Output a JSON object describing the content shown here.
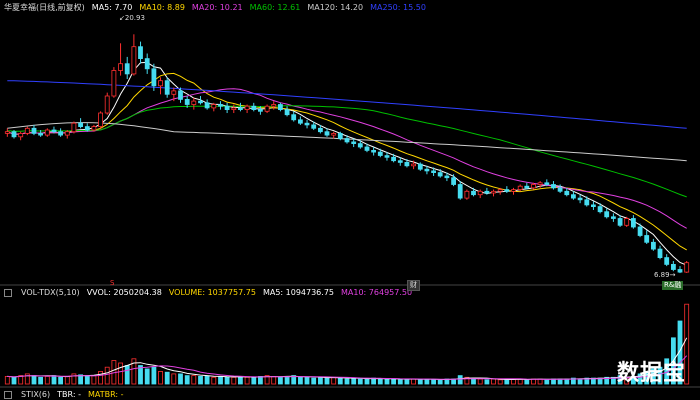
{
  "top_legend": {
    "title": "华夏幸福(日线,前复权)",
    "ma5": "MA5: 7.70",
    "ma10": "MA10: 8.89",
    "ma20": "MA20: 10.21",
    "ma60": "MA60: 12.61",
    "ma120": "MA120: 14.20",
    "ma250": "MA250: 15.50"
  },
  "volume_legend": {
    "name": "VOL-TDX(5,10)",
    "vvol": "VVOL: 2050204.38",
    "volume": "VOLUME: 1037757.75",
    "ma5": "MA5: 1094736.75",
    "ma10": "MA10: 764957.50"
  },
  "bottom_legend": {
    "name": "STIX(6)",
    "tbr": "TBR: -",
    "matbr": "MATBR: -"
  },
  "annotations": {
    "high": "20.93",
    "low": "6.89",
    "cai": "财",
    "rz": "R&融",
    "s": "S"
  },
  "watermark": "数据宝",
  "colors": {
    "up": "#ff3030",
    "down": "#46dcf0",
    "ma5": "#ffffff",
    "ma10": "#ffd700",
    "ma20": "#e040e0",
    "ma60": "#00c000",
    "ma120": "#cccccc",
    "ma250": "#3040ff"
  },
  "chart_data": {
    "type": "candlestick",
    "price_high": 20.93,
    "price_low": 6.89,
    "candles": [
      [
        15.1,
        15.4,
        14.9,
        15.2
      ],
      [
        15.2,
        15.3,
        14.8,
        14.9
      ],
      [
        14.9,
        15.2,
        14.7,
        15.1
      ],
      [
        15.1,
        15.5,
        15.0,
        15.4
      ],
      [
        15.4,
        15.6,
        15.0,
        15.1
      ],
      [
        15.1,
        15.3,
        14.9,
        15.0
      ],
      [
        15.0,
        15.4,
        14.9,
        15.3
      ],
      [
        15.3,
        15.5,
        15.1,
        15.2
      ],
      [
        15.2,
        15.4,
        14.9,
        15.0
      ],
      [
        15.0,
        15.3,
        14.8,
        15.2
      ],
      [
        15.2,
        15.8,
        15.1,
        15.7
      ],
      [
        15.7,
        16.0,
        15.4,
        15.5
      ],
      [
        15.5,
        15.7,
        15.2,
        15.3
      ],
      [
        15.3,
        15.6,
        15.2,
        15.5
      ],
      [
        15.5,
        16.4,
        15.4,
        16.3
      ],
      [
        16.3,
        17.5,
        16.2,
        17.3
      ],
      [
        17.3,
        19.0,
        17.2,
        18.8
      ],
      [
        18.8,
        20.4,
        18.5,
        19.2
      ],
      [
        19.2,
        19.6,
        18.3,
        18.6
      ],
      [
        18.6,
        20.93,
        18.5,
        20.2
      ],
      [
        20.2,
        20.5,
        19.2,
        19.5
      ],
      [
        19.5,
        19.8,
        18.6,
        18.9
      ],
      [
        18.9,
        19.2,
        17.6,
        17.9
      ],
      [
        17.9,
        18.4,
        17.4,
        18.2
      ],
      [
        18.2,
        18.4,
        17.2,
        17.4
      ],
      [
        17.4,
        17.8,
        17.0,
        17.6
      ],
      [
        17.6,
        17.8,
        16.9,
        17.1
      ],
      [
        17.1,
        17.3,
        16.6,
        16.8
      ],
      [
        16.8,
        17.2,
        16.5,
        17.0
      ],
      [
        17.0,
        17.3,
        16.8,
        16.9
      ],
      [
        16.9,
        17.1,
        16.5,
        16.6
      ],
      [
        16.6,
        16.9,
        16.4,
        16.8
      ],
      [
        16.8,
        17.0,
        16.5,
        16.7
      ],
      [
        16.7,
        16.9,
        16.3,
        16.5
      ],
      [
        16.5,
        16.8,
        16.3,
        16.6
      ],
      [
        16.6,
        16.9,
        16.4,
        16.5
      ],
      [
        16.5,
        16.8,
        16.3,
        16.7
      ],
      [
        16.7,
        16.9,
        16.4,
        16.5
      ],
      [
        16.5,
        16.7,
        16.2,
        16.4
      ],
      [
        16.4,
        16.8,
        16.3,
        16.7
      ],
      [
        16.7,
        17.0,
        16.5,
        16.8
      ],
      [
        16.8,
        16.9,
        16.4,
        16.5
      ],
      [
        16.5,
        16.7,
        16.1,
        16.2
      ],
      [
        16.2,
        16.4,
        15.8,
        15.9
      ],
      [
        15.9,
        16.1,
        15.6,
        15.7
      ],
      [
        15.7,
        15.9,
        15.4,
        15.6
      ],
      [
        15.6,
        15.8,
        15.3,
        15.4
      ],
      [
        15.4,
        15.6,
        15.1,
        15.2
      ],
      [
        15.2,
        15.4,
        14.9,
        15.0
      ],
      [
        15.0,
        15.2,
        14.8,
        15.1
      ],
      [
        15.1,
        15.2,
        14.7,
        14.8
      ],
      [
        14.8,
        15.0,
        14.5,
        14.6
      ],
      [
        14.6,
        14.8,
        14.3,
        14.5
      ],
      [
        14.5,
        14.7,
        14.2,
        14.3
      ],
      [
        14.3,
        14.5,
        14.0,
        14.1
      ],
      [
        14.1,
        14.3,
        13.8,
        14.0
      ],
      [
        14.0,
        14.2,
        13.7,
        13.8
      ],
      [
        13.8,
        14.0,
        13.5,
        13.7
      ],
      [
        13.7,
        13.9,
        13.4,
        13.5
      ],
      [
        13.5,
        13.7,
        13.2,
        13.4
      ],
      [
        13.4,
        13.6,
        13.1,
        13.2
      ],
      [
        13.2,
        13.5,
        13.0,
        13.3
      ],
      [
        13.3,
        13.4,
        12.9,
        13.0
      ],
      [
        13.0,
        13.2,
        12.7,
        12.9
      ],
      [
        12.9,
        13.1,
        12.6,
        12.8
      ],
      [
        12.8,
        13.0,
        12.5,
        12.6
      ],
      [
        12.6,
        12.8,
        12.3,
        12.5
      ],
      [
        12.5,
        12.7,
        12.0,
        12.1
      ],
      [
        12.1,
        12.3,
        11.2,
        11.3
      ],
      [
        11.3,
        11.8,
        11.2,
        11.7
      ],
      [
        11.7,
        11.9,
        11.4,
        11.5
      ],
      [
        11.5,
        11.8,
        11.3,
        11.7
      ],
      [
        11.7,
        11.9,
        11.5,
        11.6
      ],
      [
        11.6,
        11.8,
        11.4,
        11.7
      ],
      [
        11.7,
        11.9,
        11.5,
        11.8
      ],
      [
        11.8,
        12.0,
        11.6,
        11.7
      ],
      [
        11.7,
        11.9,
        11.5,
        11.8
      ],
      [
        11.8,
        12.1,
        11.7,
        12.0
      ],
      [
        12.0,
        12.2,
        11.8,
        11.9
      ],
      [
        11.9,
        12.2,
        11.8,
        12.1
      ],
      [
        12.1,
        12.3,
        11.9,
        12.2
      ],
      [
        12.2,
        12.4,
        12.0,
        12.1
      ],
      [
        12.1,
        12.3,
        11.8,
        11.9
      ],
      [
        11.9,
        12.1,
        11.6,
        11.7
      ],
      [
        11.7,
        11.9,
        11.4,
        11.5
      ],
      [
        11.5,
        11.7,
        11.2,
        11.3
      ],
      [
        11.3,
        11.5,
        11.0,
        11.2
      ],
      [
        11.2,
        11.4,
        10.8,
        10.9
      ],
      [
        10.9,
        11.1,
        10.6,
        10.8
      ],
      [
        10.8,
        11.0,
        10.4,
        10.5
      ],
      [
        10.5,
        10.7,
        10.1,
        10.2
      ],
      [
        10.2,
        10.4,
        9.9,
        10.1
      ],
      [
        10.1,
        10.3,
        9.6,
        9.7
      ],
      [
        9.7,
        10.2,
        9.6,
        10.1
      ],
      [
        10.1,
        10.3,
        9.5,
        9.6
      ],
      [
        9.6,
        9.8,
        9.0,
        9.1
      ],
      [
        9.1,
        9.4,
        8.6,
        8.7
      ],
      [
        8.7,
        8.9,
        8.2,
        8.3
      ],
      [
        8.3,
        8.5,
        7.7,
        7.8
      ],
      [
        7.8,
        8.0,
        7.3,
        7.4
      ],
      [
        7.4,
        7.6,
        7.0,
        7.1
      ],
      [
        7.1,
        7.3,
        6.89,
        6.95
      ],
      [
        6.95,
        7.6,
        6.9,
        7.5
      ]
    ],
    "volume": [
      0.09,
      0.08,
      0.1,
      0.12,
      0.1,
      0.08,
      0.09,
      0.1,
      0.08,
      0.09,
      0.12,
      0.11,
      0.1,
      0.1,
      0.15,
      0.2,
      0.28,
      0.25,
      0.22,
      0.3,
      0.22,
      0.18,
      0.2,
      0.15,
      0.14,
      0.12,
      0.12,
      0.1,
      0.1,
      0.09,
      0.09,
      0.08,
      0.09,
      0.08,
      0.08,
      0.09,
      0.08,
      0.08,
      0.09,
      0.1,
      0.09,
      0.08,
      0.09,
      0.1,
      0.08,
      0.08,
      0.07,
      0.08,
      0.07,
      0.08,
      0.07,
      0.06,
      0.07,
      0.06,
      0.06,
      0.07,
      0.06,
      0.06,
      0.06,
      0.05,
      0.06,
      0.06,
      0.05,
      0.06,
      0.05,
      0.05,
      0.06,
      0.06,
      0.1,
      0.08,
      0.06,
      0.06,
      0.05,
      0.06,
      0.05,
      0.05,
      0.06,
      0.06,
      0.05,
      0.06,
      0.06,
      0.05,
      0.06,
      0.06,
      0.06,
      0.07,
      0.06,
      0.07,
      0.07,
      0.07,
      0.08,
      0.08,
      0.1,
      0.08,
      0.09,
      0.12,
      0.15,
      0.18,
      0.2,
      0.3,
      0.55,
      0.75,
      0.95
    ]
  }
}
